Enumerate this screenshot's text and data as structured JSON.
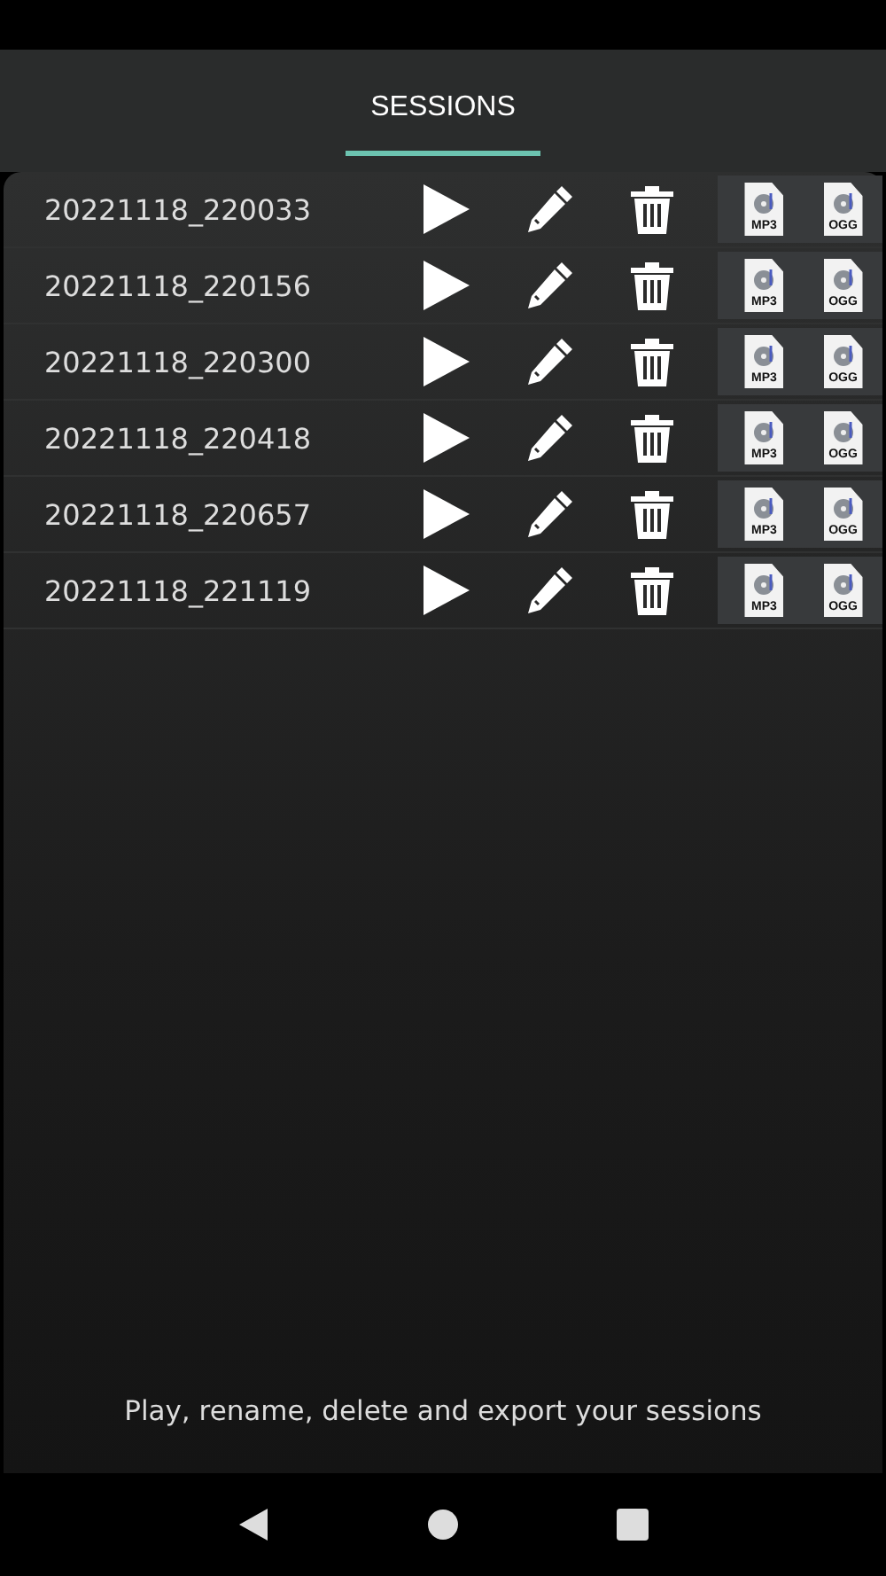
{
  "tabs": [
    {
      "label": "SESSIONS",
      "selected": true
    }
  ],
  "sessions": [
    {
      "name": "20221118_220033",
      "exports": [
        "MP3",
        "OGG"
      ]
    },
    {
      "name": "20221118_220156",
      "exports": [
        "MP3",
        "OGG"
      ]
    },
    {
      "name": "20221118_220300",
      "exports": [
        "MP3",
        "OGG"
      ]
    },
    {
      "name": "20221118_220418",
      "exports": [
        "MP3",
        "OGG"
      ]
    },
    {
      "name": "20221118_220657",
      "exports": [
        "MP3",
        "OGG"
      ]
    },
    {
      "name": "20221118_221119",
      "exports": [
        "MP3",
        "OGG"
      ]
    }
  ],
  "footer": "Play, rename, delete and export your sessions"
}
